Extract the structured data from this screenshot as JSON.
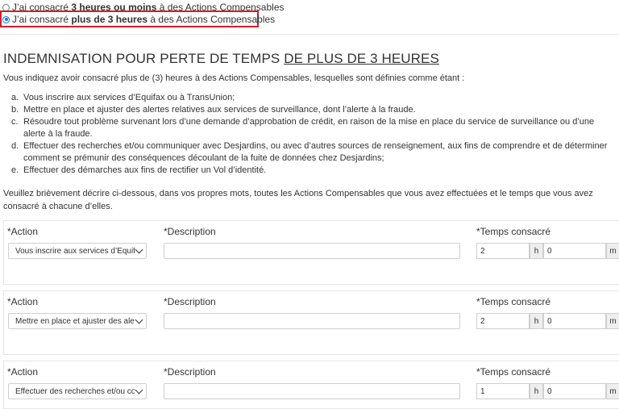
{
  "options": {
    "opt1": {
      "pre": "J’ai consacré ",
      "bold": "3 heures ou moins",
      "post": " à des Actions Compensables",
      "selected": false
    },
    "opt2": {
      "pre": "J’ai consacré ",
      "bold": "plus de 3 heures",
      "post": " à des Actions Compensables",
      "selected": true
    }
  },
  "section": {
    "title_pre": "INDEMNISATION POUR PERTE DE TEMPS ",
    "title_underlined": "DE PLUS DE 3 HEURES",
    "intro": "Vous indiquez avoir consacré plus de (3) heures à des Actions Compensables, lesquelles sont définies comme étant :",
    "list": [
      {
        "marker": "a.",
        "text": "Vous inscrire aux services d’Equifax ou à TransUnion;"
      },
      {
        "marker": "b.",
        "text": "Mettre en place et ajuster des alertes relatives aux services de surveillance, dont l’alerte à la fraude."
      },
      {
        "marker": "c.",
        "text": "Résoudre tout problème survenant lors d’une demande d’approbation de crédit, en raison de la mise en place du service de surveillance ou d’une alerte à la fraude."
      },
      {
        "marker": "d.",
        "text": "Effectuer des recherches et/ou communiquer avec Desjardins, ou avec d’autres sources de renseignement, aux fins de comprendre et de déterminer comment se prémunir des conséquences découlant de la fuite de données chez Desjardins;"
      },
      {
        "marker": "e.",
        "text": "Effectuer des démarches aux fins de rectifier un Vol d’identité."
      }
    ],
    "instruction": "Veuillez brièvement décrire ci-dessous, dans vos propres mots, toutes les Actions Compensables que vous avez effectuées et le temps que vous avez consacré à chacune d’elles."
  },
  "labels": {
    "action": "*Action",
    "description": "*Description",
    "time": "*Temps consacré",
    "h": "h",
    "m": "m"
  },
  "rows": [
    {
      "action": "Vous inscrire aux services d’Equifax ou à TransUnion",
      "description": "",
      "hours": "2",
      "minutes": "0"
    },
    {
      "action": "Mettre en place et ajuster des alertes",
      "description": "",
      "hours": "2",
      "minutes": "0"
    },
    {
      "action": "Effectuer des recherches et/ou communiquer",
      "description": "",
      "hours": "1",
      "minutes": "0"
    }
  ],
  "colors": {
    "highlight": "#d0202a",
    "radio_checked": "#1a73e8"
  }
}
